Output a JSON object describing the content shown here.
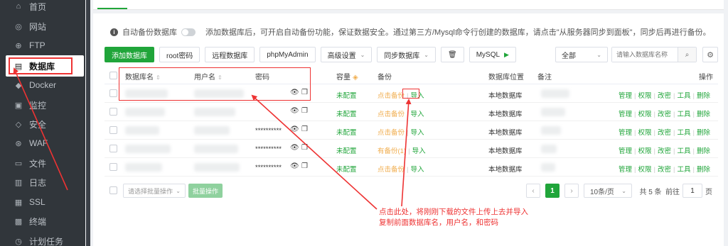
{
  "sidebar": {
    "items": [
      {
        "label": "首页",
        "icon": "home-icon",
        "glyph": "⌂"
      },
      {
        "label": "网站",
        "icon": "globe-icon",
        "glyph": "◎"
      },
      {
        "label": "FTP",
        "icon": "ftp-icon",
        "glyph": "⊕"
      },
      {
        "label": "数据库",
        "icon": "database-icon",
        "glyph": "▤",
        "active": true
      },
      {
        "label": "Docker",
        "icon": "docker-icon",
        "glyph": "◆"
      },
      {
        "label": "监控",
        "icon": "monitor-icon",
        "glyph": "▣"
      },
      {
        "label": "安全",
        "icon": "shield-icon",
        "glyph": "◇"
      },
      {
        "label": "WAF",
        "icon": "waf-icon",
        "glyph": "⊛"
      },
      {
        "label": "文件",
        "icon": "folder-icon",
        "glyph": "▭"
      },
      {
        "label": "日志",
        "icon": "log-icon",
        "glyph": "▥"
      },
      {
        "label": "SSL",
        "icon": "ssl-icon",
        "glyph": "▦"
      },
      {
        "label": "终端",
        "icon": "terminal-icon",
        "glyph": "▩"
      },
      {
        "label": "计划任务",
        "icon": "clock-icon",
        "glyph": "◷"
      }
    ]
  },
  "autobackup": {
    "label": "自动备份数据库",
    "hint": "添加数据库后，可开启自动备份功能，保证数据安全。通过第三方/Mysql命令行创建的数据库，请点击\"从服务器同步到面板\"，同步后再进行备份。"
  },
  "toolbar": {
    "add": "添加数据库",
    "root_pw": "root密码",
    "remote_db": "远程数据库",
    "phpmyadmin": "phpMyAdmin",
    "advanced": "高级设置",
    "sync": "同步数据库",
    "mysql": "MySQL",
    "filter": "全部",
    "search_placeholder": "请输入数据库名称"
  },
  "table": {
    "headers": {
      "name": "数据库名",
      "user": "用户名",
      "password": "密码",
      "capacity": "容量",
      "backup": "备份",
      "location": "数据库位置",
      "note": "备注",
      "ops": "操作"
    },
    "rows": [
      {
        "password": "",
        "capacity": "未配置",
        "backup": "点击备份",
        "import": "导入",
        "location": "本地数据库"
      },
      {
        "password": "",
        "capacity": "未配置",
        "backup": "点击备份",
        "import": "导入",
        "location": "本地数据库"
      },
      {
        "password": "**********",
        "capacity": "未配置",
        "backup": "点击备份",
        "import": "导入",
        "location": "本地数据库"
      },
      {
        "password": "**********",
        "capacity": "未配置",
        "backup": "有备份(1)",
        "import": "导入",
        "location": "本地数据库"
      },
      {
        "password": "**********",
        "capacity": "未配置",
        "backup": "点击备份",
        "import": "导入",
        "location": "本地数据库"
      }
    ],
    "actions": [
      "管理",
      "权限",
      "改密",
      "工具",
      "删除"
    ]
  },
  "footer": {
    "batch_placeholder": "请选择批量操作",
    "batch_button": "批量操作",
    "current_page": "1",
    "page_size": "10条/页",
    "total": "共 5 条",
    "goto_label": "前往",
    "goto_value": "1",
    "page_suffix": "页"
  },
  "annotation": {
    "line1": "点击此处，将刚刚下载的文件上传上去并导入",
    "line2": "复制前面数据库名，用户名，和密码",
    "color": "#e33333"
  },
  "colors": {
    "accent": "#20a53a",
    "sidebar_bg": "#31363b",
    "warn": "#f0ad4e"
  }
}
